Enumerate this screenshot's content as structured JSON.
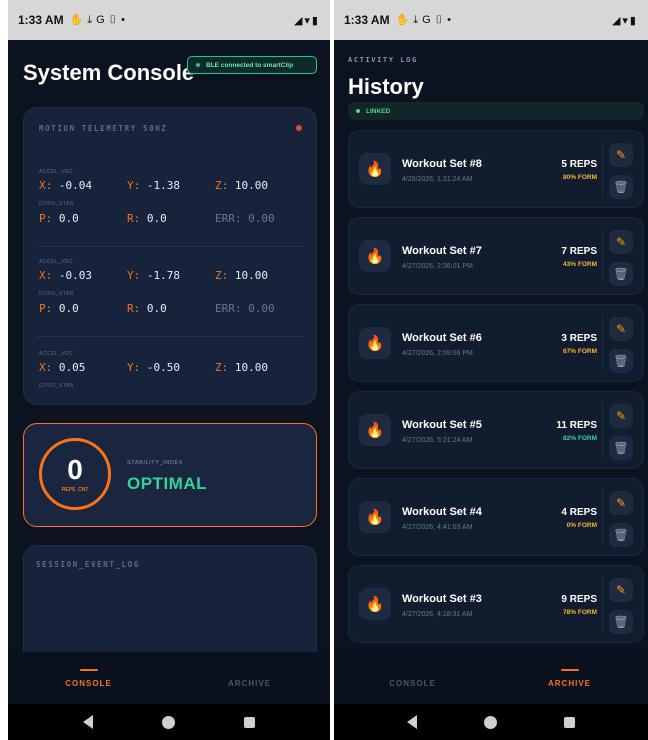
{
  "status_bar": {
    "time": "1:33 AM"
  },
  "console": {
    "title": "System Console",
    "ble_status": "BLE connected to smartClip",
    "telemetry_heading": "MOTION TELEMETRY 50HZ",
    "rows": [
      {
        "accel_label": "ACCEL_VEC",
        "x": "-0.04",
        "y": "-1.38",
        "z": "10.00",
        "gyro_label": "GYRO_STAB",
        "p": "0.0",
        "r": "0.0",
        "err": "0.00"
      },
      {
        "accel_label": "ACCEL_VEC",
        "x": "-0.03",
        "y": "-1.78",
        "z": "10.00",
        "gyro_label": "GYRO_STAB",
        "p": "0.0",
        "r": "0.0",
        "err": "0.00"
      },
      {
        "accel_label": "ACCEL_VEC",
        "x": "0.05",
        "y": "-0.50",
        "z": "10.00",
        "gyro_label": "GYRO_STAB"
      }
    ],
    "reps_count": "0",
    "reps_label": "REPS_CNT",
    "stability_label": "STABILITY_INDEX",
    "stability_value": "OPTIMAL",
    "event_log_heading": "SESSION_EVENT_LOG"
  },
  "history": {
    "section_label": "ACTIVITY LOG",
    "title": "History",
    "link_status": "LINKED",
    "workouts": [
      {
        "name": "Workout Set #8",
        "date": "4/28/2026, 1:21:24 AM",
        "reps": "5 REPS",
        "form": "80% FORM",
        "form_color": "#f5b82e"
      },
      {
        "name": "Workout Set #7",
        "date": "4/27/2026, 2:36:01 PM",
        "reps": "7 REPS",
        "form": "43% FORM",
        "form_color": "#f5b82e"
      },
      {
        "name": "Workout Set #6",
        "date": "4/27/2026, 2:09:06 PM",
        "reps": "3 REPS",
        "form": "67% FORM",
        "form_color": "#f5b82e"
      },
      {
        "name": "Workout Set #5",
        "date": "4/27/2026, 5:21:24 AM",
        "reps": "11 REPS",
        "form": "82% FORM",
        "form_color": "#34d399"
      },
      {
        "name": "Workout Set #4",
        "date": "4/27/2026, 4:41:03 AM",
        "reps": "4 REPS",
        "form": "0% FORM",
        "form_color": "#f5b82e"
      },
      {
        "name": "Workout Set #3",
        "date": "4/27/2026, 4:18:31 AM",
        "reps": "9 REPS",
        "form": "78% FORM",
        "form_color": "#f5b82e"
      }
    ]
  },
  "tabs": {
    "console": "CONSOLE",
    "archive": "ARCHIVE"
  },
  "colors": {
    "accent": "#f97316",
    "success": "#34d399",
    "background": "#0b1220",
    "card": "#16233b"
  },
  "icons": {
    "flame": "flame-icon",
    "edit": "pencil-icon",
    "delete": "trash-icon"
  }
}
